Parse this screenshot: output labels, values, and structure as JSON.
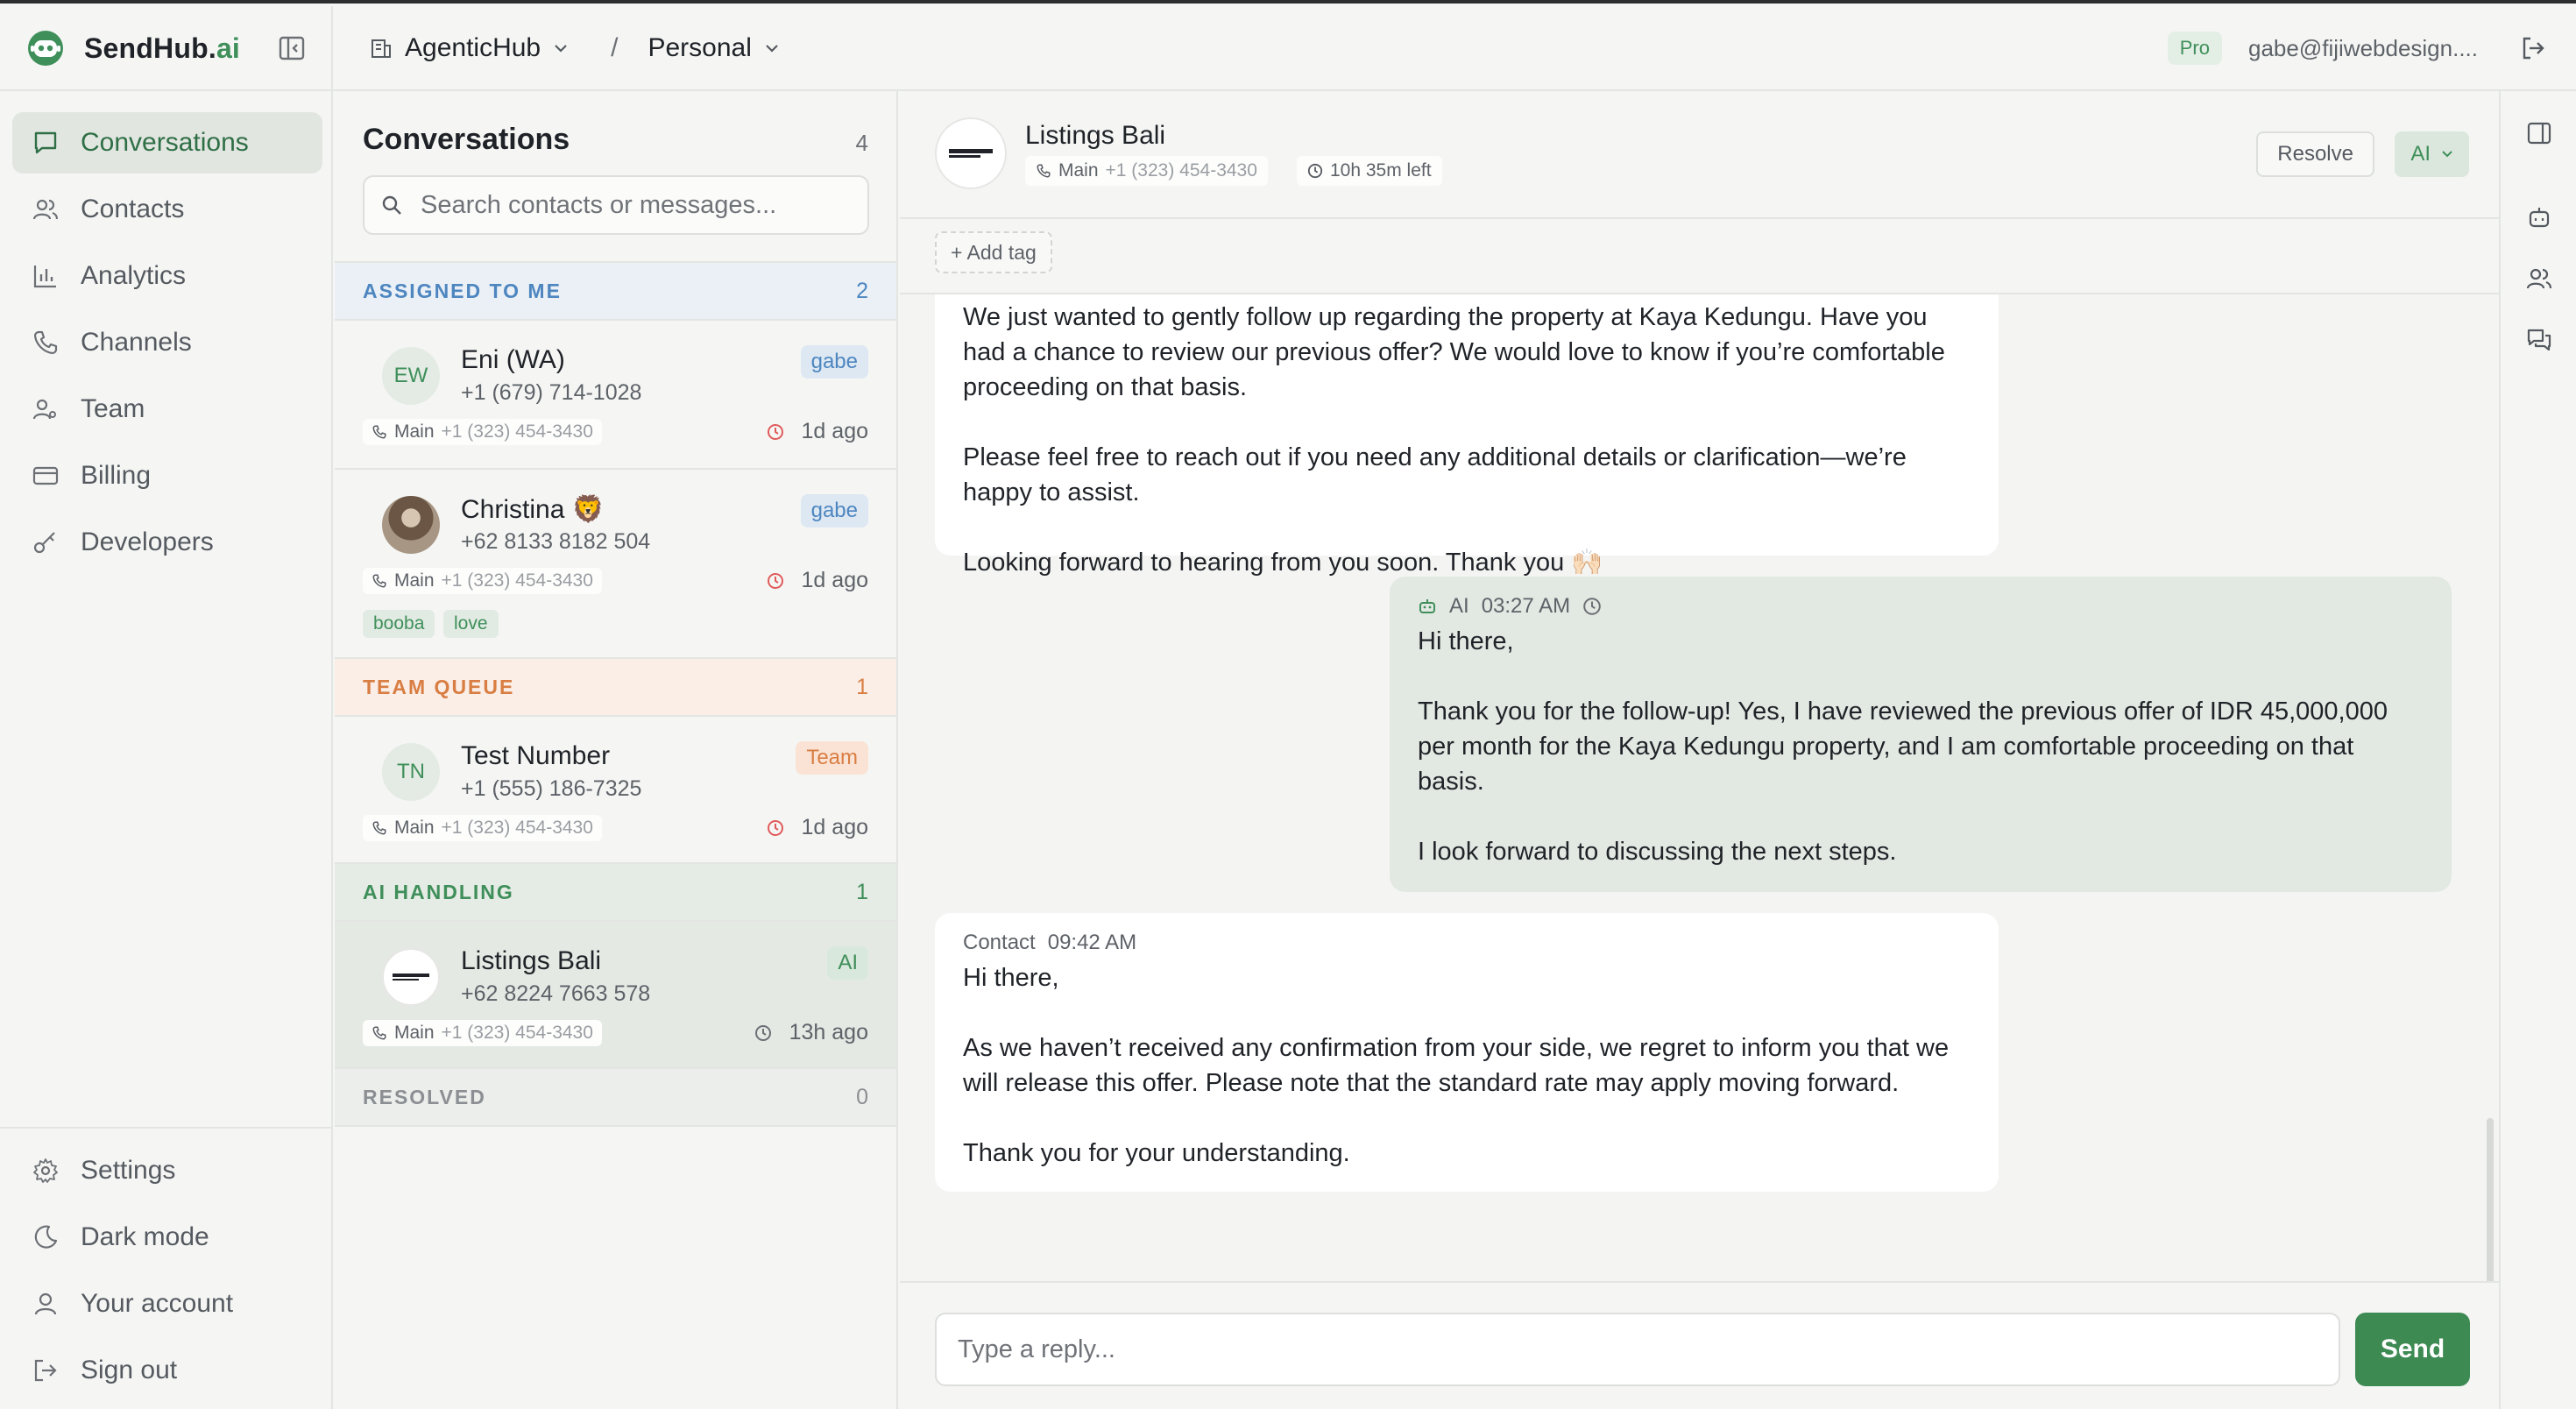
{
  "app": {
    "brand_main": "SendHub.",
    "brand_accent": "ai",
    "accent_color": "#3f8f5a"
  },
  "topbar": {
    "workspace": "AgenticHub",
    "separator": "/",
    "project": "Personal",
    "plan_badge": "Pro",
    "user_email": "gabe@fijiwebdesign...."
  },
  "nav": {
    "items": [
      {
        "label": "Conversations",
        "icon": "chat-icon"
      },
      {
        "label": "Contacts",
        "icon": "users-icon"
      },
      {
        "label": "Analytics",
        "icon": "bar-chart-icon"
      },
      {
        "label": "Channels",
        "icon": "phone-icon"
      },
      {
        "label": "Team",
        "icon": "team-icon"
      },
      {
        "label": "Billing",
        "icon": "credit-card-icon"
      },
      {
        "label": "Developers",
        "icon": "key-icon"
      }
    ],
    "bottom": [
      {
        "label": "Settings",
        "icon": "gear-icon"
      },
      {
        "label": "Dark mode",
        "icon": "moon-icon"
      },
      {
        "label": "Your account",
        "icon": "user-icon"
      },
      {
        "label": "Sign out",
        "icon": "sign-out-icon"
      }
    ]
  },
  "conversations": {
    "title": "Conversations",
    "count": "4",
    "search_placeholder": "Search contacts or messages...",
    "sections": {
      "assigned": {
        "label": "ASSIGNED TO ME",
        "count": "2"
      },
      "team": {
        "label": "TEAM QUEUE",
        "count": "1"
      },
      "ai": {
        "label": "AI HANDLING",
        "count": "1"
      },
      "resolved": {
        "label": "RESOLVED",
        "count": "0"
      }
    },
    "items": [
      {
        "initials": "EW",
        "name": "Eni (WA)",
        "phone": "+1 (679) 714-1028",
        "tag": "gabe",
        "line": "Main",
        "line_number": "+1 (323) 454-3430",
        "when": "1d ago"
      },
      {
        "initials": "",
        "name": "Christina 🦁",
        "phone": "+62 8133 8182 504",
        "tag": "gabe",
        "line": "Main",
        "line_number": "+1 (323) 454-3430",
        "when": "1d ago",
        "chips": [
          "booba",
          "love"
        ]
      },
      {
        "initials": "TN",
        "name": "Test Number",
        "phone": "+1 (555) 186-7325",
        "tag": "Team",
        "line": "Main",
        "line_number": "+1 (323) 454-3430",
        "when": "1d ago"
      },
      {
        "initials": "",
        "name": "Listings Bali",
        "phone": "+62 8224 7663 578",
        "tag": "AI",
        "line": "Main",
        "line_number": "+1 (323) 454-3430",
        "when": "13h ago"
      }
    ]
  },
  "chat": {
    "contact_name": "Listings Bali",
    "avatar_text": "LISTINGS.",
    "line": "Main",
    "line_number": "+1 (323) 454-3430",
    "sla": "10h 35m left",
    "resolve_label": "Resolve",
    "mode_label": "AI",
    "add_tag_label": "+ Add tag",
    "messages": [
      {
        "direction": "in",
        "paragraphs": [
          "We just wanted to gently follow up regarding the property at Kaya Kedungu. Have you had a chance to review our previous offer? We would love to know if you’re comfortable proceeding on that basis.",
          "Please feel free to reach out if you need any additional details or clarification—we’re happy to assist.",
          "Looking forward to hearing from you soon. Thank you 🙌🏻"
        ]
      },
      {
        "direction": "out",
        "sender": "AI",
        "time": "03:27 AM",
        "paragraphs": [
          "Hi there,",
          "Thank you for the follow-up! Yes, I have reviewed the previous offer of IDR 45,000,000 per month for the Kaya Kedungu property, and I am comfortable proceeding on that basis.",
          "I look forward to discussing the next steps."
        ]
      },
      {
        "direction": "in",
        "sender": "Contact",
        "time": "09:42 AM",
        "paragraphs": [
          "Hi there,",
          "As we haven’t received any confirmation from your side, we regret to inform you that we will release this offer. Please note that the standard rate may apply moving forward.",
          "Thank you for your understanding."
        ]
      }
    ],
    "reply_placeholder": "Type a reply...",
    "send_label": "Send"
  },
  "rail": {
    "icons": [
      "panel-toggle-icon",
      "bot-icon",
      "contacts-icon",
      "messages-icon"
    ]
  }
}
